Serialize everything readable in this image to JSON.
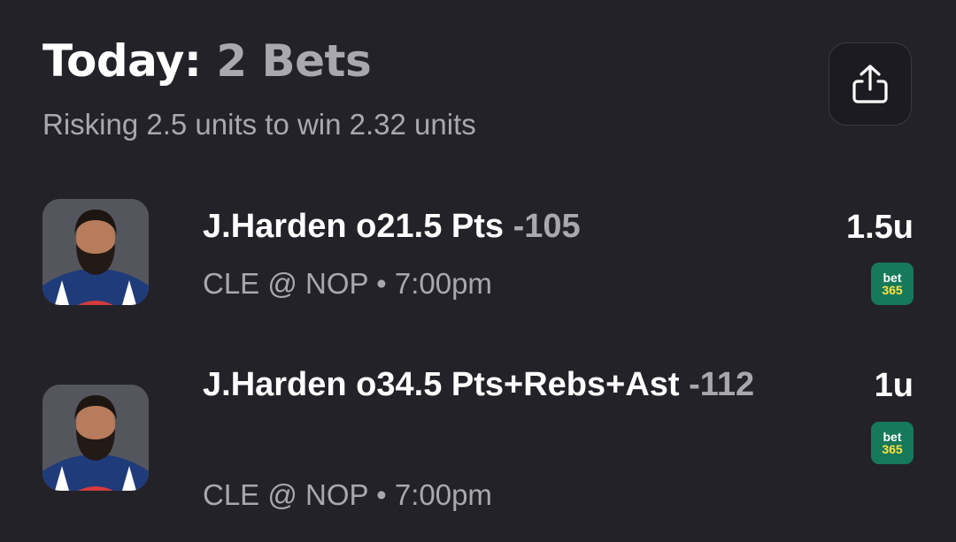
{
  "header": {
    "title_label": "Today:",
    "title_count": "2 Bets",
    "subtitle": "Risking 2.5 units to win 2.32 units",
    "share_icon": "share-icon"
  },
  "bets": [
    {
      "title": "J.Harden o21.5 Pts",
      "odds": "-105",
      "meta": "CLE @ NOP • 7:00pm",
      "units": "1.5u",
      "book_line1": "bet",
      "book_line2": "365",
      "avatar_icon": "player-avatar"
    },
    {
      "title": "J.Harden o34.5 Pts+Rebs+Ast",
      "odds": "-112",
      "meta": "CLE @ NOP • 7:00pm",
      "units": "1u",
      "book_line1": "bet",
      "book_line2": "365",
      "avatar_icon": "player-avatar"
    }
  ],
  "colors": {
    "background": "#232229",
    "muted_text": "#a9a8ae",
    "book_green": "#167a5a",
    "book_yellow": "#ffe140"
  }
}
